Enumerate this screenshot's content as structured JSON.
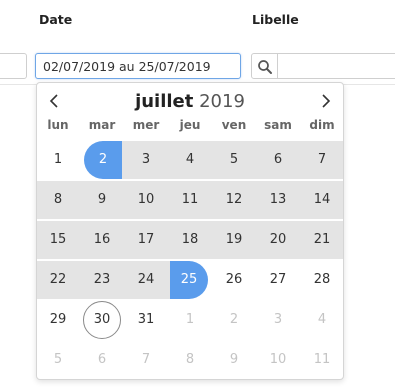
{
  "filters": {
    "date_label": "Date",
    "libelle_label": "Libelle",
    "date_value": "02/07/2019 au 25/07/2019",
    "libelle_value": ""
  },
  "calendar": {
    "month": "juillet",
    "year": "2019",
    "weekdays": [
      "lun",
      "mar",
      "mer",
      "jeu",
      "ven",
      "sam",
      "dim"
    ],
    "weeks": [
      [
        {
          "d": "1"
        },
        {
          "d": "2",
          "state": "start"
        },
        {
          "d": "3",
          "state": "in"
        },
        {
          "d": "4",
          "state": "in"
        },
        {
          "d": "5",
          "state": "in"
        },
        {
          "d": "6",
          "state": "in"
        },
        {
          "d": "7",
          "state": "in"
        }
      ],
      [
        {
          "d": "8",
          "state": "in"
        },
        {
          "d": "9",
          "state": "in"
        },
        {
          "d": "10",
          "state": "in"
        },
        {
          "d": "11",
          "state": "in"
        },
        {
          "d": "12",
          "state": "in"
        },
        {
          "d": "13",
          "state": "in"
        },
        {
          "d": "14",
          "state": "in"
        }
      ],
      [
        {
          "d": "15",
          "state": "in"
        },
        {
          "d": "16",
          "state": "in"
        },
        {
          "d": "17",
          "state": "in"
        },
        {
          "d": "18",
          "state": "in"
        },
        {
          "d": "19",
          "state": "in"
        },
        {
          "d": "20",
          "state": "in"
        },
        {
          "d": "21",
          "state": "in"
        }
      ],
      [
        {
          "d": "22",
          "state": "in"
        },
        {
          "d": "23",
          "state": "in"
        },
        {
          "d": "24",
          "state": "in"
        },
        {
          "d": "25",
          "state": "end"
        },
        {
          "d": "26"
        },
        {
          "d": "27"
        },
        {
          "d": "28"
        }
      ],
      [
        {
          "d": "29"
        },
        {
          "d": "30",
          "state": "today"
        },
        {
          "d": "31"
        },
        {
          "d": "1",
          "other": true
        },
        {
          "d": "2",
          "other": true
        },
        {
          "d": "3",
          "other": true
        },
        {
          "d": "4",
          "other": true
        }
      ],
      [
        {
          "d": "5",
          "other": true
        },
        {
          "d": "6",
          "other": true
        },
        {
          "d": "7",
          "other": true
        },
        {
          "d": "8",
          "other": true
        },
        {
          "d": "9",
          "other": true
        },
        {
          "d": "10",
          "other": true
        },
        {
          "d": "11",
          "other": true
        }
      ]
    ]
  },
  "colors": {
    "accent": "#5a9cec",
    "range": "#e4e4e4",
    "other_month_text": "#c4c4c4"
  },
  "icons": {
    "search": "search-icon",
    "prev": "chevron-left-icon",
    "next": "chevron-right-icon"
  }
}
